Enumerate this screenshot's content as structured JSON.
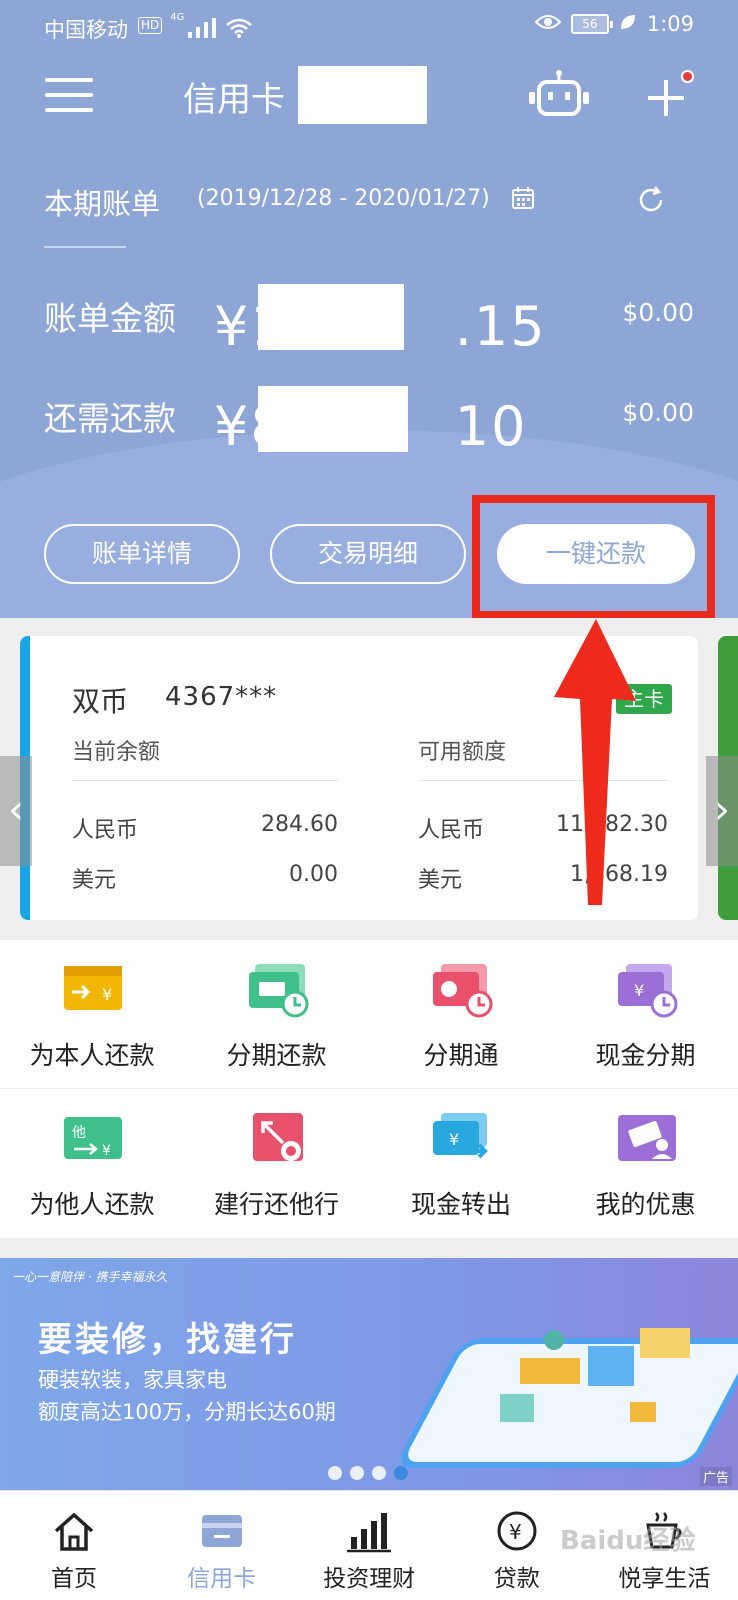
{
  "status_bar": {
    "carrier": "中国移动",
    "hd": "HD",
    "network": "4G",
    "battery": "56",
    "time": "1:09"
  },
  "app": {
    "title": "信用卡 •"
  },
  "bill": {
    "period_label": "本期账单",
    "period_range": "(2019/12/28 - 2020/01/27)",
    "amount_label": "账单金额",
    "amount_value": "¥1　　　.15",
    "amount_usd": "$0.00",
    "due_label": "还需还款",
    "due_value": "¥8　　　10",
    "due_usd": "$0.00"
  },
  "actions": {
    "detail": "账单详情",
    "transactions": "交易明细",
    "quick_pay": "一键还款"
  },
  "card": {
    "name": "双币",
    "number": "4367***",
    "badge": "主卡",
    "balance_header": "当前余额",
    "credit_header": "可用额度",
    "rmb_label": "人民币",
    "usd_label": "美元",
    "balance_rmb": "284.60",
    "balance_usd": "0.00",
    "credit_rmb": "11,082.30",
    "credit_usd": "1,668.19"
  },
  "grid": [
    {
      "label": "为本人还款",
      "icon": "self-repay-icon",
      "color": "#f2b705"
    },
    {
      "label": "分期还款",
      "icon": "installment-repay-icon",
      "color": "#3fbf8a"
    },
    {
      "label": "分期通",
      "icon": "installment-pass-icon",
      "color": "#e8506b"
    },
    {
      "label": "现金分期",
      "icon": "cash-installment-icon",
      "color": "#9b6fd6"
    },
    {
      "label": "为他人还款",
      "icon": "repay-others-icon",
      "color": "#3fbf8a"
    },
    {
      "label": "建行还他行",
      "icon": "repay-other-bank-icon",
      "color": "#e8506b"
    },
    {
      "label": "现金转出",
      "icon": "cash-transfer-icon",
      "color": "#29a8e0"
    },
    {
      "label": "我的优惠",
      "icon": "my-offers-icon",
      "color": "#9b6fd6"
    }
  ],
  "banner": {
    "tagline": "一心一意陪伴 · 携手幸福永久",
    "title": "要装修，找建行",
    "line1": "硬装软装，家具家电",
    "line2": "额度高达100万，分期长达60期",
    "ad": "广告"
  },
  "tabs": [
    {
      "label": "首页",
      "icon": "home-icon"
    },
    {
      "label": "信用卡",
      "icon": "credit-card-icon",
      "active": true
    },
    {
      "label": "投资理财",
      "icon": "investment-chart-icon"
    },
    {
      "label": "贷款",
      "icon": "loan-yen-icon"
    },
    {
      "label": "悦享生活",
      "icon": "coffee-cup-icon"
    }
  ],
  "watermark": "Baidu经验"
}
